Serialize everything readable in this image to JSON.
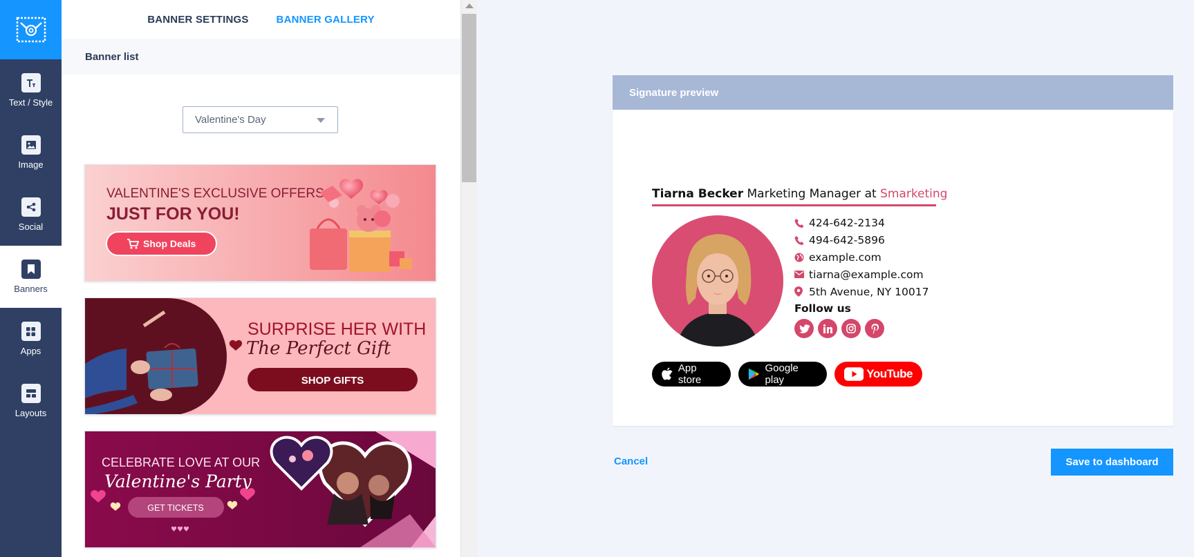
{
  "nav": {
    "items": [
      {
        "label": "Text / Style",
        "icon": "text-style-icon"
      },
      {
        "label": "Image",
        "icon": "image-icon"
      },
      {
        "label": "Social",
        "icon": "share-icon"
      },
      {
        "label": "Banners",
        "icon": "bookmark-icon",
        "active": true
      },
      {
        "label": "Apps",
        "icon": "apps-grid-icon"
      },
      {
        "label": "Layouts",
        "icon": "layout-icon"
      }
    ]
  },
  "tabs": {
    "settings": "BANNER SETTINGS",
    "gallery": "BANNER GALLERY"
  },
  "banner_list": {
    "title": "Banner list",
    "selected_category": "Valentine's Day"
  },
  "banners": [
    {
      "line1": "VALENTINE'S EXCLUSIVE OFFERS",
      "line2": "JUST FOR YOU!",
      "cta": "Shop Deals"
    },
    {
      "line1": "SURPRISE HER WITH",
      "line2": "The Perfect Gift",
      "cta": "SHOP GIFTS"
    },
    {
      "line1": "CELEBRATE LOVE AT OUR",
      "line2": "Valentine's Party",
      "cta": "GET TICKETS"
    }
  ],
  "preview": {
    "header": "Signature preview",
    "name": "Tiarna Becker",
    "role": "Marketing Manager at",
    "company": "Smarketing",
    "contacts": [
      {
        "icon": "phone-icon",
        "text": "424-642-2134"
      },
      {
        "icon": "phone-icon",
        "text": "494-642-5896"
      },
      {
        "icon": "globe-icon",
        "text": "example.com"
      },
      {
        "icon": "mail-icon",
        "text": "tiarna@example.com"
      },
      {
        "icon": "location-pin-icon",
        "text": "5th Avenue, NY 10017"
      }
    ],
    "follow_label": "Follow us",
    "socials": [
      "twitter-icon",
      "linkedin-icon",
      "instagram-icon",
      "pinterest-icon"
    ],
    "app_store": "App store",
    "google_play": "Google play",
    "youtube": "YouTube"
  },
  "actions": {
    "cancel": "Cancel",
    "save": "Save to dashboard"
  },
  "colors": {
    "accent": "#1495ff",
    "nav": "#2f4064",
    "brand_pink": "#d4476a",
    "preview_header": "#a6b8d6"
  }
}
